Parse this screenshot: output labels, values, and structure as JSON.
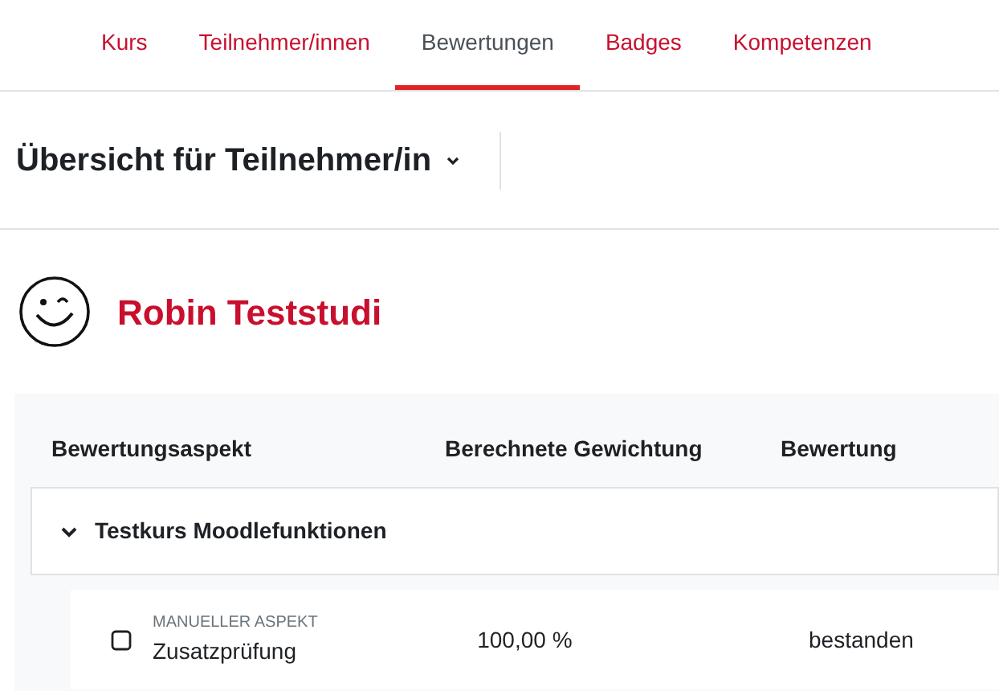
{
  "tabs": [
    {
      "label": "Kurs",
      "selected": false
    },
    {
      "label": "Teilnehmer/innen",
      "selected": false
    },
    {
      "label": "Bewertungen",
      "selected": true
    },
    {
      "label": "Badges",
      "selected": false
    },
    {
      "label": "Kompetenzen",
      "selected": false
    }
  ],
  "report_selector": {
    "label": "Übersicht für Teilnehmer/in"
  },
  "user": {
    "name": "Robin Teststudi"
  },
  "table": {
    "columns": [
      "Bewertungsaspekt",
      "Berechnete Gewichtung",
      "Bewertung"
    ],
    "category": {
      "name": "Testkurs Moodlefunktionen",
      "expanded": true
    },
    "rows": [
      {
        "type": "MANUELLER ASPEKT",
        "name": "Zusatzprüfung",
        "weight": "100,00 %",
        "grade": "bestanden"
      }
    ]
  }
}
